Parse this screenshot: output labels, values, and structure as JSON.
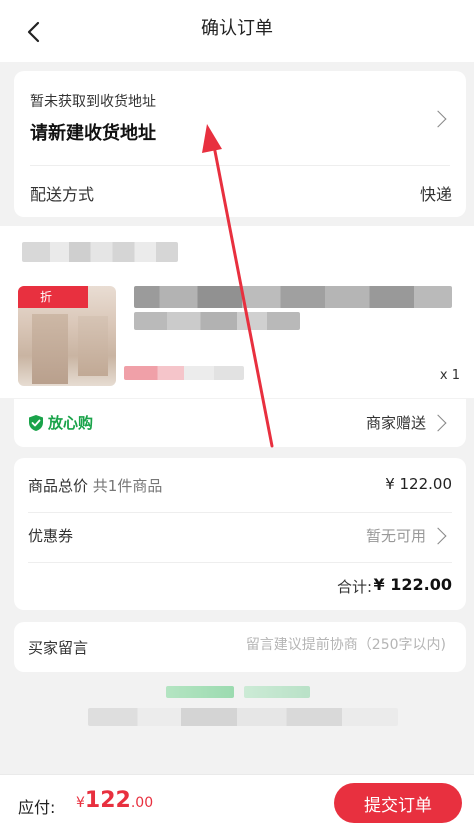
{
  "header": {
    "title": "确认订单",
    "back_icon": "chevron-left-icon"
  },
  "address": {
    "hint": "暂未获取到收货地址",
    "cta": "请新建收货地址"
  },
  "shipping": {
    "label": "配送方式",
    "value": "快递"
  },
  "goods": {
    "thumb_tag": "折",
    "quantity": "x 1"
  },
  "service": {
    "label": "放心购",
    "value": "商家赠送",
    "icon": "shield-check-icon",
    "accent": "#1aa34a"
  },
  "pricing": {
    "total_label": "商品总价",
    "total_count": "共1件商品",
    "total_value": "¥ 122.00",
    "coupon_label": "优惠券",
    "coupon_value": "暂无可用",
    "sum_label": "合计:",
    "sum_value": "¥ 122.00"
  },
  "message": {
    "label": "买家留言",
    "placeholder": "留言建议提前协商（250字以内)"
  },
  "footer": {
    "pay_label": "应付:",
    "pay_symbol": "¥",
    "pay_int": "122",
    "pay_dec": ".00",
    "submit_label": "提交订单",
    "accent": "#e8303f"
  }
}
